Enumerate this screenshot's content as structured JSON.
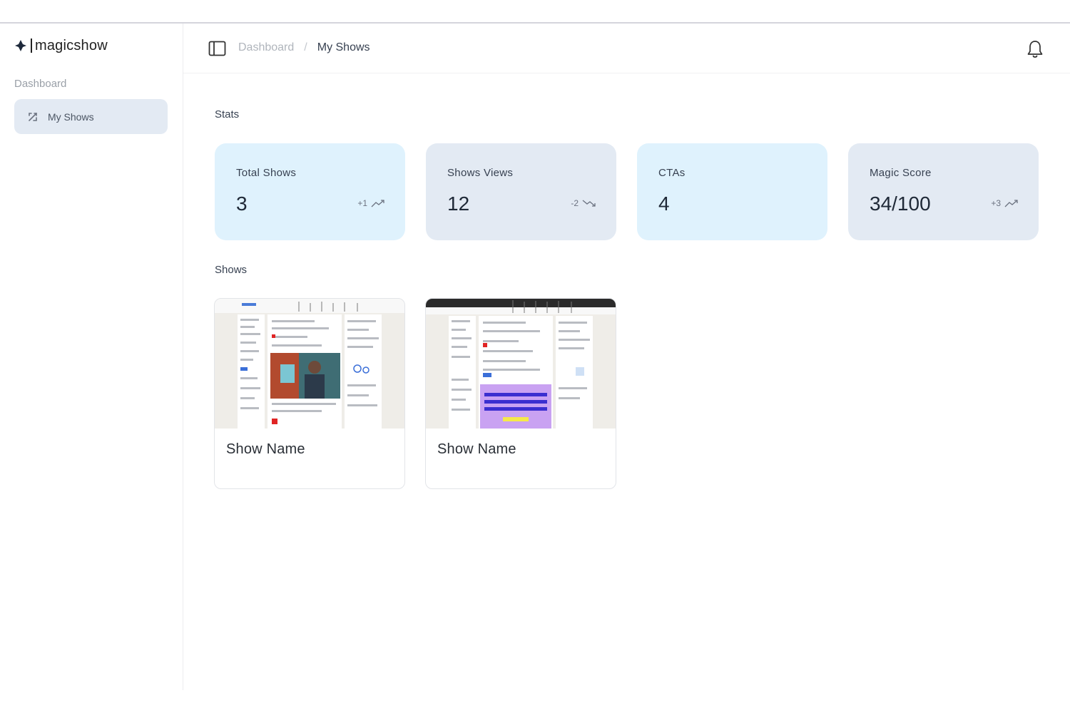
{
  "app": {
    "brand": "magicshow"
  },
  "sidebar": {
    "section": "Dashboard",
    "items": [
      {
        "label": "My Shows",
        "icon": "shows-icon",
        "active": true
      }
    ]
  },
  "header": {
    "breadcrumb": [
      "Dashboard",
      "/",
      "My Shows"
    ],
    "notifications_icon": "bell-icon"
  },
  "stats": {
    "title": "Stats",
    "cards": [
      {
        "label": "Total Shows",
        "value": "3",
        "delta": "+1",
        "trend": "up"
      },
      {
        "label": "Shows Views",
        "value": "12",
        "delta": "-2",
        "trend": "down"
      },
      {
        "label": "CTAs",
        "value": "4",
        "delta": "",
        "trend": "none"
      },
      {
        "label": "Magic Score",
        "value": "34/100",
        "delta": "+3",
        "trend": "up"
      }
    ]
  },
  "shows": {
    "title": "Shows",
    "items": [
      {
        "name": "Show Name",
        "thumbnail": "browser-page-screenshot-photo"
      },
      {
        "name": "Show Name",
        "thumbnail": "browser-page-screenshot-purple-banner"
      }
    ]
  },
  "colors": {
    "card_light": "#dff2fd",
    "card_gray": "#e3eaf3",
    "sidebar_active": "#e3eaf3",
    "text_dark": "#1f2937",
    "text_muted": "#9aa0a8"
  }
}
